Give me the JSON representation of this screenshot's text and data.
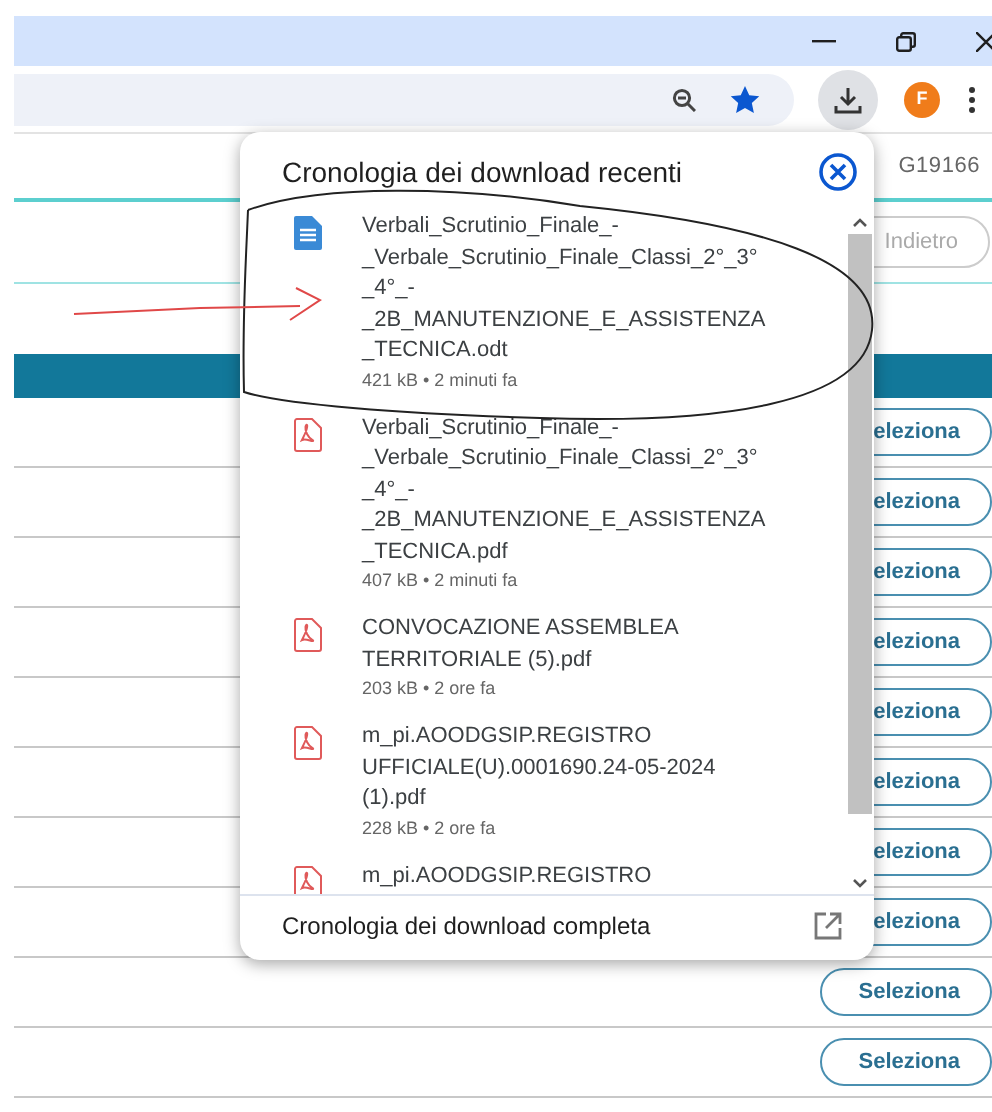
{
  "browser": {
    "avatar_letter": "F"
  },
  "page": {
    "id_text": "G19166",
    "back_button": "Indietro",
    "rows": [
      {
        "button": "eleziona"
      },
      {
        "button": "eleziona"
      },
      {
        "button": "eleziona"
      },
      {
        "button": "eleziona"
      },
      {
        "button": "eleziona"
      },
      {
        "button": "eleziona"
      },
      {
        "button": "eleziona"
      },
      {
        "button": "eleziona"
      },
      {
        "button": "Seleziona"
      },
      {
        "button": "Seleziona"
      }
    ]
  },
  "downloads_popup": {
    "title": "Cronologia dei download recenti",
    "items": [
      {
        "kind": "odt",
        "name_lines": [
          "Verbali_Scrutinio_Finale_-",
          "_Verbale_Scrutinio_Finale_Classi_2°_3°",
          "_4°_-",
          "_2B_MANUTENZIONE_E_ASSISTENZA",
          "_TECNICA.odt"
        ],
        "meta": "421 kB • 2 minuti fa"
      },
      {
        "kind": "pdf",
        "name_lines": [
          "Verbali_Scrutinio_Finale_-",
          "_Verbale_Scrutinio_Finale_Classi_2°_3°",
          "_4°_-",
          "_2B_MANUTENZIONE_E_ASSISTENZA",
          "_TECNICA.pdf"
        ],
        "meta": "407 kB • 2 minuti fa"
      },
      {
        "kind": "pdf",
        "name_lines": [
          "CONVOCAZIONE ASSEMBLEA",
          "TERRITORIALE (5).pdf"
        ],
        "meta": "203 kB • 2 ore fa"
      },
      {
        "kind": "pdf",
        "name_lines": [
          "m_pi.AOODGSIP.REGISTRO",
          "UFFICIALE(U).0001690.24-05-2024",
          "(1).pdf"
        ],
        "meta": "228 kB • 2 ore fa"
      },
      {
        "kind": "pdf",
        "name_lines": [
          "m_pi.AOODGSIP.REGISTRO"
        ]
      }
    ],
    "footer_link": "Cronologia dei download completa"
  }
}
